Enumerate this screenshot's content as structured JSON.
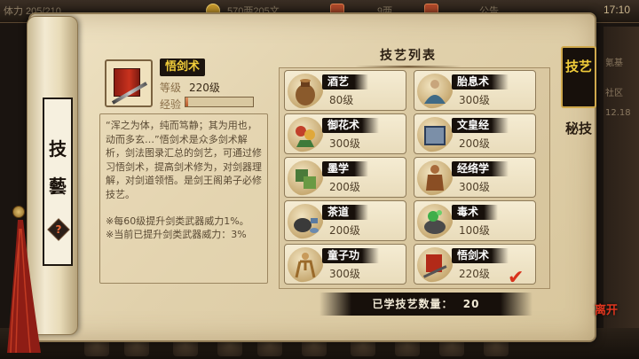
{
  "topbar": {
    "energy": "体力 205/210",
    "copper": "570两205文",
    "silver": "9两",
    "announce": "公告",
    "time": "17:10"
  },
  "background_right": [
    "氪基",
    "社区",
    "12.18"
  ],
  "roller": {
    "char1": "技",
    "char2": "藝",
    "help": "?"
  },
  "detail": {
    "name": "悟剑术",
    "level_label": "等级",
    "level": "220级",
    "exp_label": "经验",
    "exp_progress": 0.04,
    "description": "“浑之为体，纯而笃静；其为用也，动而多玄…”悟剑术是众多剑术解析，剑法图录汇总的剑艺，可通过修习悟剑术，提高剑术修为，对剑器理解，对剑道领悟。是剑王阁弟子必修技艺。",
    "note1": "※每60级提升剑类武器威力1%。",
    "note2": "※当前已提升剑类武器威力：3%"
  },
  "list": {
    "title": "技艺列表",
    "items": [
      {
        "name": "酒艺",
        "level": "80级",
        "icon": "wine-jar-icon"
      },
      {
        "name": "胎息术",
        "level": "300级",
        "icon": "meditating-monk-icon"
      },
      {
        "name": "御花术",
        "level": "300级",
        "icon": "flower-icon"
      },
      {
        "name": "文皇经",
        "level": "200级",
        "icon": "scripture-book-icon"
      },
      {
        "name": "墨学",
        "level": "200级",
        "icon": "mechanism-icon"
      },
      {
        "name": "经络学",
        "level": "300级",
        "icon": "meridian-figure-icon"
      },
      {
        "name": "茶道",
        "level": "200级",
        "icon": "teapot-icon"
      },
      {
        "name": "毒术",
        "level": "100级",
        "icon": "poison-cauldron-icon"
      },
      {
        "name": "童子功",
        "level": "300级",
        "icon": "child-martial-icon"
      },
      {
        "name": "悟剑术",
        "level": "220级",
        "icon": "sword-manual-icon"
      }
    ],
    "learned_label": "已学技艺数量：",
    "learned_count": "20"
  },
  "tabs": {
    "skills": "技艺",
    "secrets": "秘技"
  },
  "close_label": "离开"
}
